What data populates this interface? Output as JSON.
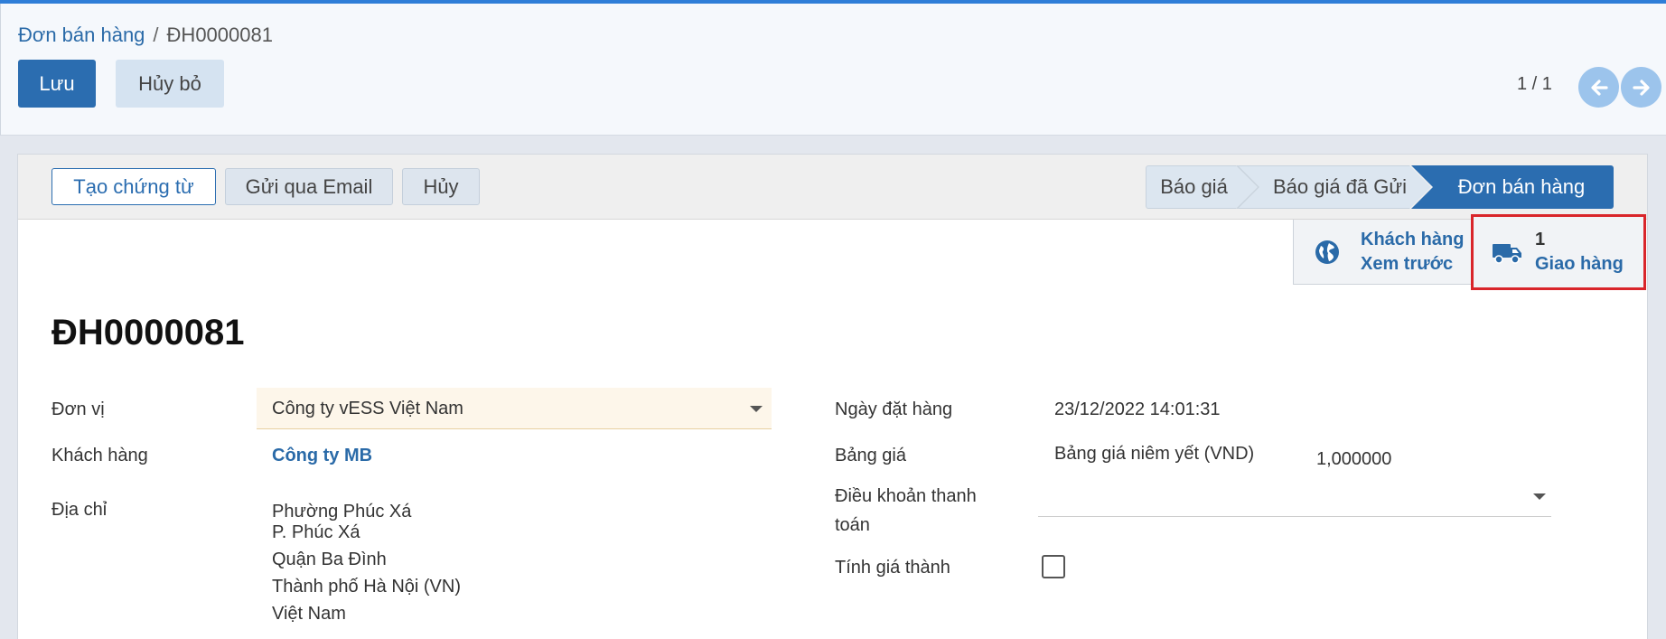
{
  "breadcrumb": {
    "parent": "Đơn bán hàng",
    "separator": "/",
    "current": "ĐH0000081"
  },
  "actions": {
    "save": "Lưu",
    "discard": "Hủy bỏ"
  },
  "pager": {
    "value": "1 / 1",
    "prev_icon": "arrow-left-icon",
    "next_icon": "arrow-right-icon"
  },
  "statusbar": {
    "buttons": {
      "create_voucher": "Tạo chứng từ",
      "send_email": "Gửi qua Email",
      "cancel": "Hủy"
    },
    "stages": [
      {
        "label": "Báo giá",
        "active": false
      },
      {
        "label": "Báo giá đã Gửi",
        "active": false
      },
      {
        "label": "Đơn bán hàng",
        "active": true
      }
    ]
  },
  "smart_buttons": {
    "customer_preview": {
      "icon": "globe-icon",
      "line1": "Khách hàng",
      "line2": "Xem trước"
    },
    "delivery": {
      "icon": "truck-icon",
      "count": "1",
      "label": "Giao hàng",
      "highlighted": true
    }
  },
  "document": {
    "title": "ĐH0000081"
  },
  "fields": {
    "unit": {
      "label": "Đơn vị",
      "value": "Công ty vESS Việt Nam"
    },
    "customer": {
      "label": "Khách hàng",
      "value": "Công ty MB"
    },
    "address": {
      "label": "Địa chỉ",
      "lines": [
        "Phường Phúc Xá",
        "P. Phúc Xá",
        "Quận Ba Đình",
        "Thành phố Hà Nội (VN)",
        "Việt Nam"
      ]
    },
    "order_date": {
      "label": "Ngày đặt hàng",
      "value": "23/12/2022 14:01:31"
    },
    "pricelist": {
      "label": "Bảng giá",
      "value": "Bảng giá niêm yết (VND)",
      "rate": "1,000000"
    },
    "payment_terms": {
      "label_line1": "Điều khoản thanh",
      "label_line2": "toán",
      "value": ""
    },
    "costing": {
      "label": "Tính giá thành",
      "checked": false
    }
  },
  "colors": {
    "primary": "#2b6db0",
    "link": "#2a6aa8",
    "highlight_border": "#d9252a",
    "required_field_bg": "#fdf6ea"
  }
}
